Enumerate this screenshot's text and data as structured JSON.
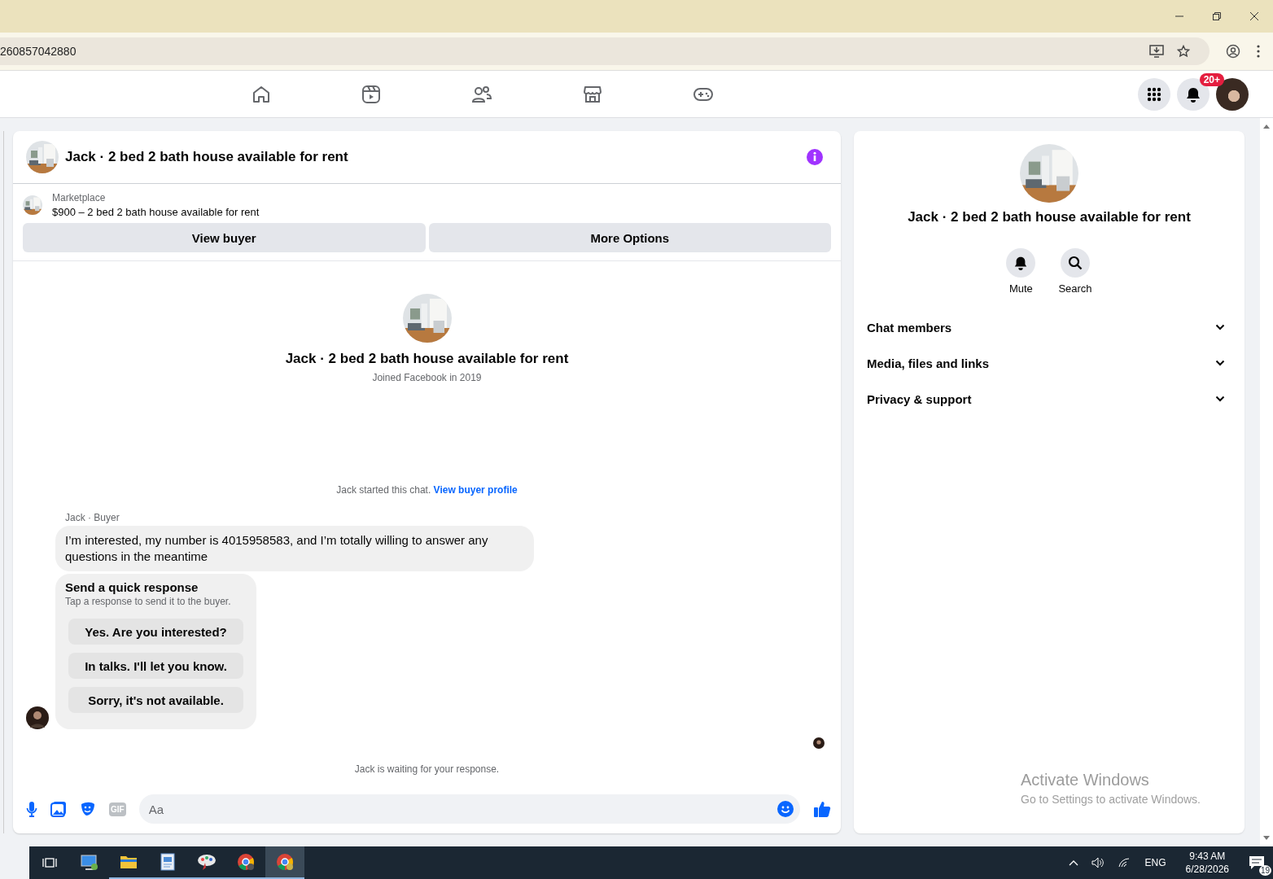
{
  "browser": {
    "url": "260857042880"
  },
  "notifications": {
    "badge": "20+"
  },
  "chat": {
    "title": "Jack · 2 bed 2 bath house available for rent",
    "listing": {
      "label": "Marketplace",
      "title": "$900 – 2 bed 2 bath house available for rent"
    },
    "actions": [
      "View buyer",
      "More Options"
    ],
    "profile": {
      "name": "Jack · 2 bed 2 bath house available for rent",
      "joined": "Joined Facebook in 2019"
    },
    "started": {
      "text": "Jack started this chat.",
      "link": "View buyer profile"
    },
    "sender": "Jack · Buyer",
    "message": "I’m interested, my number is 4015958583, and I’m totally willing to answer any questions in the meantime",
    "quick": {
      "title": "Send a quick response",
      "hint": "Tap a response to send it to the buyer.",
      "options": [
        "Yes. Are you interested?",
        "In talks. I'll let you know.",
        "Sorry, it's not available."
      ]
    },
    "waiting": "Jack is waiting for your response.",
    "composer": {
      "placeholder": "Aa",
      "gif": "GIF"
    }
  },
  "details": {
    "name": "Jack · 2 bed 2 bath house available for rent",
    "actions": [
      {
        "kind": "mute",
        "label": "Mute"
      },
      {
        "kind": "search",
        "label": "Search"
      }
    ],
    "sections": [
      {
        "label": "Chat members",
        "expanded": false
      },
      {
        "label": "Media, files and links",
        "expanded": false
      },
      {
        "label": "Privacy & support",
        "expanded": false
      }
    ]
  },
  "activation": {
    "title": "Activate Windows",
    "text": "Go to Settings to activate Windows."
  },
  "taskbar": {
    "language": "ENG",
    "time": "9:43 AM",
    "date": "6/28/2026",
    "notifications": "19"
  }
}
